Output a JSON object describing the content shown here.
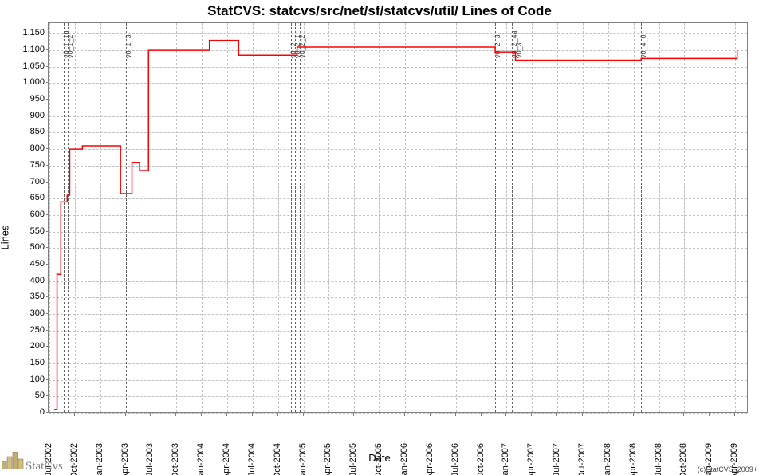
{
  "chart_data": {
    "type": "line",
    "title": "StatCVS: statcvs/src/net/sf/statcvs/util/ Lines of Code",
    "xlabel": "Date",
    "ylabel": "Lines",
    "ylim": [
      0,
      1180
    ],
    "y_ticks": [
      0,
      50,
      100,
      150,
      200,
      250,
      300,
      350,
      400,
      450,
      500,
      550,
      600,
      650,
      700,
      750,
      800,
      850,
      900,
      950,
      1000,
      1050,
      1100,
      1150
    ],
    "xlim_index": [
      0,
      27.5
    ],
    "x_tick_labels": [
      "Jul-2002",
      "Oct-2002",
      "Jan-2003",
      "Apr-2003",
      "Jul-2003",
      "Oct-2003",
      "Jan-2004",
      "Apr-2004",
      "Jul-2004",
      "Oct-2004",
      "Jan-2005",
      "Apr-2005",
      "Jul-2005",
      "Oct-2005",
      "Jan-2006",
      "Apr-2006",
      "Jul-2006",
      "Oct-2006",
      "Jan-2007",
      "Apr-2007",
      "Jul-2007",
      "Oct-2007",
      "Jan-2008",
      "Apr-2008",
      "Jul-2008",
      "Oct-2008",
      "Jan-2009",
      "Apr-2009"
    ],
    "versions": [
      {
        "label": "v0_1_1b",
        "x": 0.58
      },
      {
        "label": "v0_1_2",
        "x": 0.72
      },
      {
        "label": "v0_1_3",
        "x": 3.0
      },
      {
        "label": "v0_2",
        "x": 9.5
      },
      {
        "label": "v0_2_1",
        "x": 9.68
      },
      {
        "label": "v0_2_2",
        "x": 9.86
      },
      {
        "label": "v0_2_3",
        "x": 17.55
      },
      {
        "label": "v0_2_4a",
        "x": 18.2
      },
      {
        "label": "v0_3",
        "x": 18.4
      },
      {
        "label": "v0_4_0",
        "x": 23.3
      }
    ],
    "series": [
      {
        "name": "Lines of Code",
        "points": [
          [
            0.18,
            10
          ],
          [
            0.3,
            10
          ],
          [
            0.3,
            420
          ],
          [
            0.45,
            420
          ],
          [
            0.45,
            640
          ],
          [
            0.7,
            640
          ],
          [
            0.7,
            660
          ],
          [
            0.8,
            660
          ],
          [
            0.8,
            800
          ],
          [
            1.3,
            800
          ],
          [
            1.3,
            810
          ],
          [
            2.8,
            810
          ],
          [
            2.8,
            665
          ],
          [
            3.25,
            665
          ],
          [
            3.25,
            760
          ],
          [
            3.55,
            760
          ],
          [
            3.55,
            735
          ],
          [
            3.9,
            735
          ],
          [
            3.9,
            1100
          ],
          [
            6.3,
            1100
          ],
          [
            6.3,
            1130
          ],
          [
            7.45,
            1130
          ],
          [
            7.45,
            1085
          ],
          [
            9.75,
            1085
          ],
          [
            9.75,
            1110
          ],
          [
            17.55,
            1110
          ],
          [
            17.55,
            1095
          ],
          [
            18.35,
            1095
          ],
          [
            18.35,
            1070
          ],
          [
            23.3,
            1070
          ],
          [
            23.3,
            1075
          ],
          [
            27.08,
            1075
          ],
          [
            27.08,
            1100
          ]
        ]
      }
    ]
  },
  "branding": {
    "text": "StatCvs",
    "copyright": "(c)StatCVS, 2009+"
  }
}
